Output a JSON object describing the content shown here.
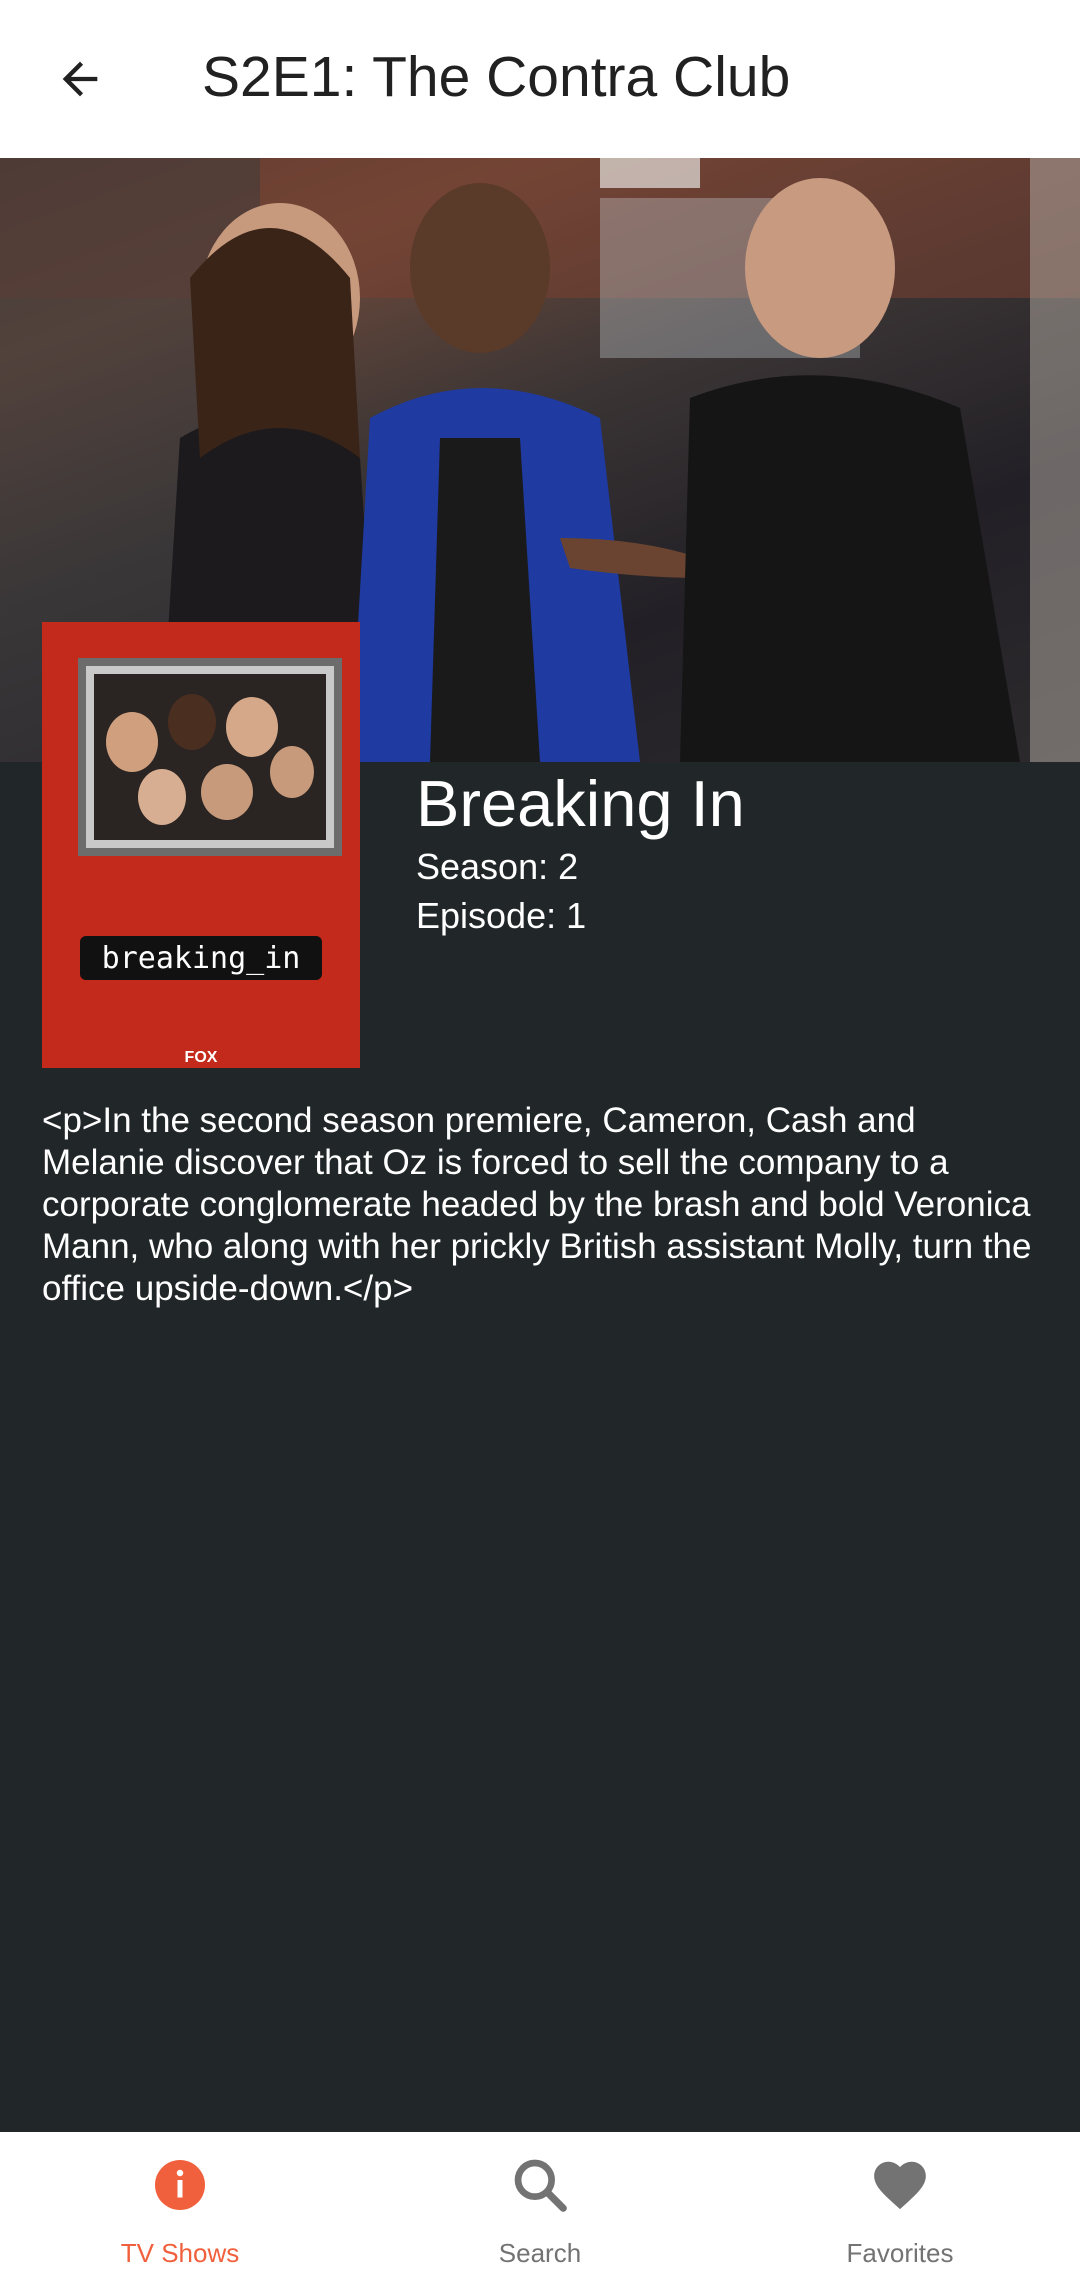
{
  "app_bar": {
    "title": "S2E1: The Contra Club",
    "back_icon": "arrow-left-icon"
  },
  "episode": {
    "show_name": "Breaking In",
    "season_label": "Season: 2",
    "episode_label": "Episode: 1",
    "summary": "<p>In the second season premiere, Cameron, Cash and Melanie discover that Oz is forced to sell the company to a corporate conglomerate headed by the brash and bold Veronica Mann, who along with her prickly British assistant Molly, turn the office upside-down.</p>",
    "poster_title_text": "breaking_in",
    "poster_network_text": "FOX"
  },
  "bottom_nav": {
    "items": [
      {
        "label": "TV Shows",
        "icon": "info-icon",
        "active": true
      },
      {
        "label": "Search",
        "icon": "search-icon",
        "active": false
      },
      {
        "label": "Favorites",
        "icon": "heart-icon",
        "active": false
      }
    ]
  },
  "colors": {
    "accent": "#f0603c",
    "content_bg": "#212729",
    "inactive": "#737373"
  }
}
